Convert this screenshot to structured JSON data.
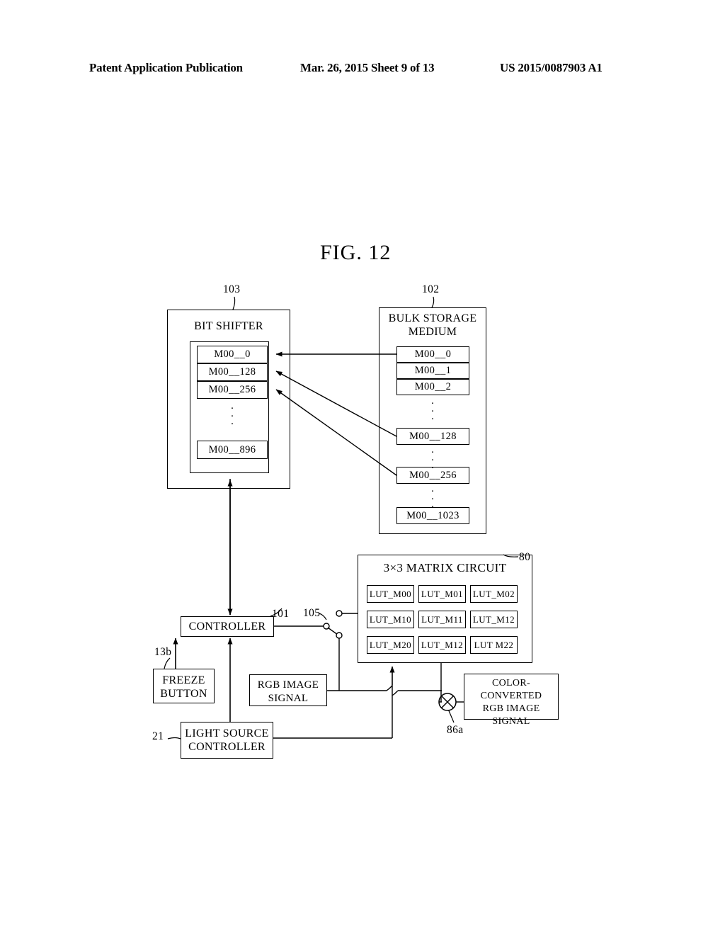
{
  "header": {
    "left": "Patent Application Publication",
    "middle": "Mar. 26, 2015  Sheet 9 of 13",
    "right": "US 2015/0087903 A1"
  },
  "figure": {
    "title": "FIG. 12"
  },
  "bit_shifter": {
    "ref": "103",
    "title": "BIT SHIFTER",
    "cells": [
      "M00__0",
      "M00__128",
      "M00__256"
    ],
    "last_cell": "M00__896",
    "dots": "·"
  },
  "bulk_storage": {
    "ref": "102",
    "title": "BULK STORAGE\nMEDIUM",
    "cells_top": [
      "M00__0",
      "M00__1",
      "M00__2"
    ],
    "cell_128": "M00__128",
    "cell_256": "M00__256",
    "cell_1023": "M00__1023",
    "dots": "·"
  },
  "matrix_circuit": {
    "ref": "80",
    "title": "3×3 MATRIX CIRCUIT",
    "luts": [
      [
        "LUT_M00",
        "LUT_M01",
        "LUT_M02"
      ],
      [
        "LUT_M10",
        "LUT_M11",
        "LUT_M12"
      ],
      [
        "LUT_M20",
        "LUT_M12",
        "LUT M22"
      ]
    ]
  },
  "controller": {
    "ref": "101",
    "label": "CONTROLLER"
  },
  "switch": {
    "ref": "105"
  },
  "freeze_button": {
    "ref": "13b",
    "label": "FREEZE\nBUTTON"
  },
  "rgb_image_signal": {
    "label": "RGB IMAGE\nSIGNAL"
  },
  "light_source_controller": {
    "ref": "21",
    "label": "LIGHT SOURCE\nCONTROLLER"
  },
  "color_converted": {
    "label": "COLOR-CONVERTED\nRGB IMAGE\nSIGNAL"
  },
  "multiplier": {
    "ref": "86a"
  }
}
